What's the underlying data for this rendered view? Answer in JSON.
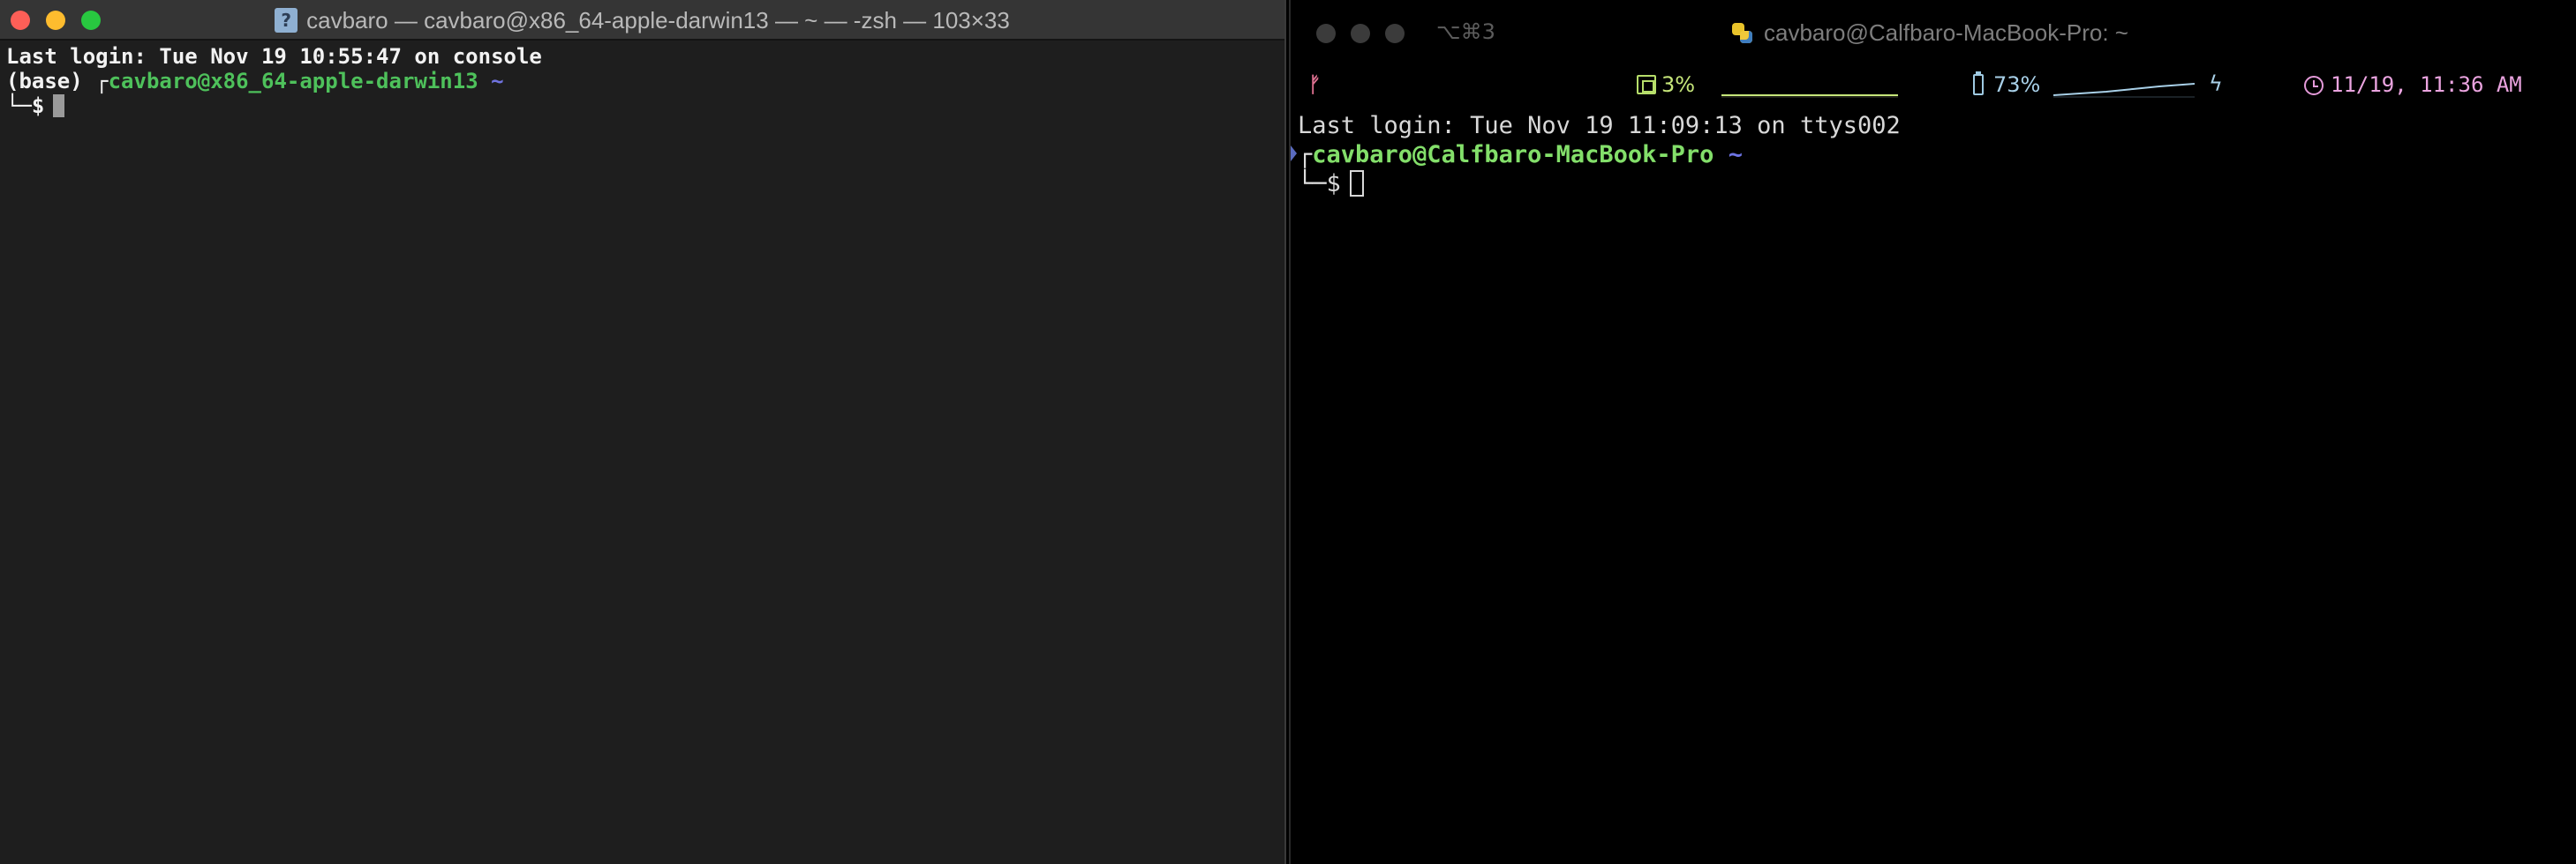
{
  "left_window": {
    "title": "cavbaro — cavbaro@x86_64-apple-darwin13 — ~ — -zsh — 103×33",
    "doc_icon_glyph": "?",
    "lines": {
      "last_login": "Last login: Tue Nov 19 10:55:47 on console",
      "env": "(base)",
      "corner_top": "┌",
      "user_host": "cavbaro@x86_64-apple-darwin13",
      "path": "~",
      "corner_bottom": "└─",
      "prompt": "$"
    },
    "colors": {
      "background": "#1e1e1e",
      "user_host": "#4ec15b",
      "path": "#7073e0"
    }
  },
  "right_window": {
    "shortcut": "⌥⌘3",
    "title": "cavbaro@Calfbaro-MacBook-Pro: ~",
    "status_bar": {
      "git_icon": "ᚠ",
      "cpu_percent": "3%",
      "battery_percent": "73%",
      "charging_icon": "ϟ",
      "datetime": "11/19, 11:36 AM"
    },
    "lines": {
      "last_login": "Last login: Tue Nov 19 11:09:13 on ttys002",
      "corner_top": "┌",
      "user_host": "cavbaro@Calfbaro-MacBook-Pro",
      "path": "~",
      "corner_bottom": "└─",
      "prompt": "$"
    },
    "colors": {
      "background": "#000000",
      "user_host": "#83df6a",
      "path": "#6d74e4",
      "cpu": "#c6e67a",
      "battery": "#a8d0e8",
      "clock": "#eba4e0"
    }
  }
}
